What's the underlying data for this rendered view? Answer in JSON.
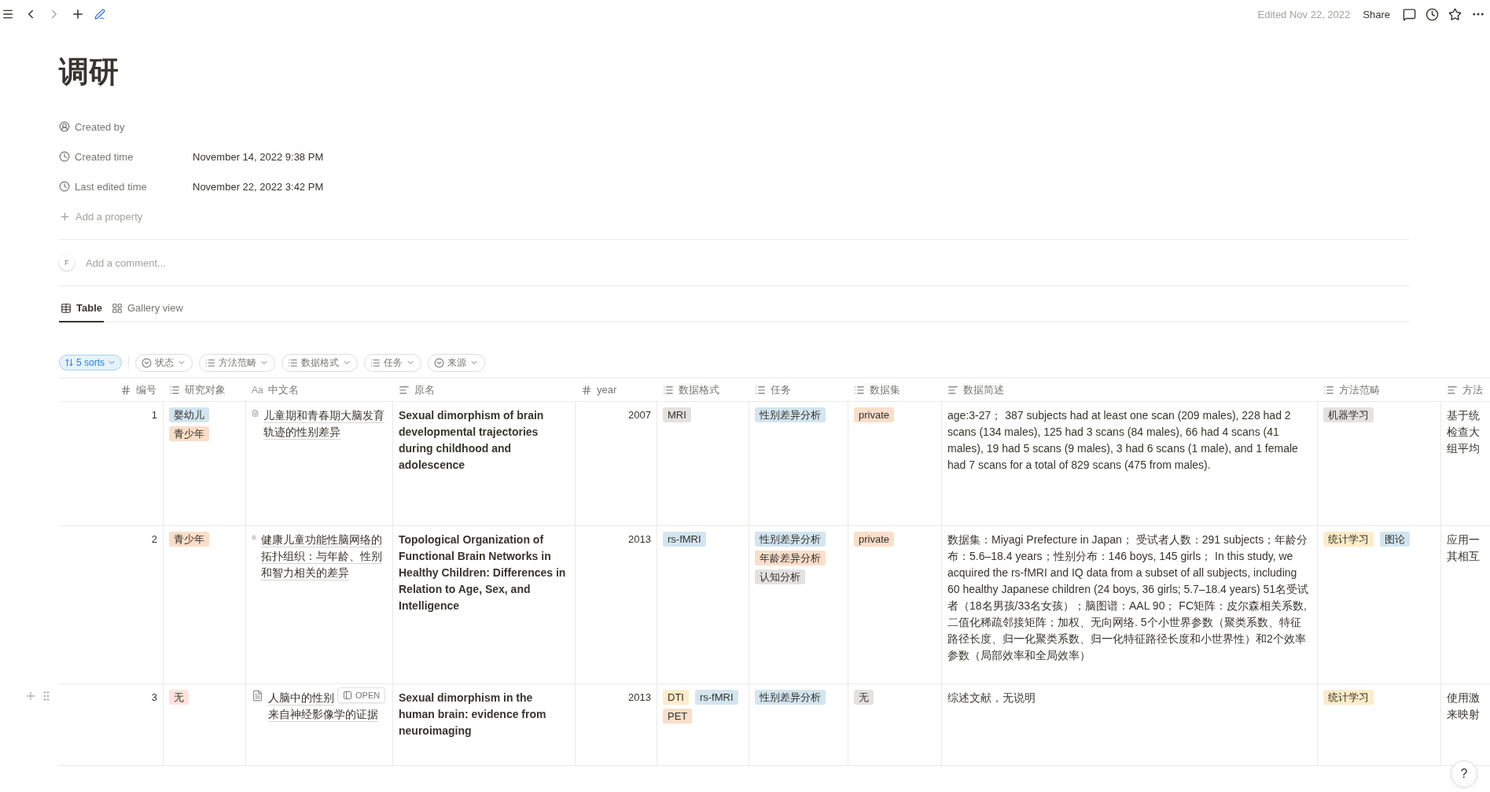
{
  "topbar": {
    "edited": "Edited Nov 22, 2022",
    "share": "Share"
  },
  "title": "调研",
  "properties": [
    {
      "kind": "person",
      "label": "Created by"
    },
    {
      "kind": "time",
      "label": "Created time",
      "value": "November 14, 2022 9:38 PM"
    },
    {
      "kind": "time",
      "label": "Last edited time",
      "value": "November 22, 2022 3:42 PM"
    }
  ],
  "add_property": "Add a property",
  "comment": {
    "avatar": "F",
    "placeholder": "Add a comment..."
  },
  "views": [
    {
      "kind": "table",
      "label": "Table",
      "selected": true
    },
    {
      "kind": "gallery",
      "label": "Gallery view",
      "selected": false
    }
  ],
  "sorts": {
    "label": "5 sorts",
    "active": true
  },
  "filters": [
    {
      "kind": "select",
      "label": "状态"
    },
    {
      "kind": "multi_select",
      "label": "方法范畴"
    },
    {
      "kind": "multi_select",
      "label": "数据格式"
    },
    {
      "kind": "multi_select",
      "label": "任务"
    },
    {
      "kind": "select",
      "label": "来源"
    }
  ],
  "table": {
    "columns": [
      {
        "label": "编号",
        "kind": "number"
      },
      {
        "label": "研究对象",
        "kind": "multi_select"
      },
      {
        "label": "中文名",
        "kind": "title",
        "prefix": "Aa"
      },
      {
        "label": "原名",
        "kind": "text",
        "bold": true
      },
      {
        "label": "year",
        "kind": "number"
      },
      {
        "label": "数据格式",
        "kind": "multi_select"
      },
      {
        "label": "任务",
        "kind": "multi_select"
      },
      {
        "label": "数据集",
        "kind": "multi_select"
      },
      {
        "label": "数据简述",
        "kind": "text",
        "bold": false
      },
      {
        "label": "方法范畴",
        "kind": "multi_select"
      },
      {
        "label": "方法",
        "kind": "text",
        "bold": false
      }
    ],
    "rows": [
      {
        "hovered": false,
        "cells": [
          "1",
          [
            {
              "label": "婴幼儿",
              "color": "#d3e5ef"
            },
            {
              "label": "青少年",
              "color": "#fadec9"
            }
          ],
          {
            "text": "儿童期和青春期大脑发育轨迹的性别差异"
          },
          "Sexual dimorphism of brain developmental trajectories during childhood and adolescence",
          "2007",
          [
            {
              "label": "MRI",
              "color": "#e3e2e0"
            }
          ],
          [
            {
              "label": "性别差异分析",
              "color": "#d3e5ef"
            }
          ],
          [
            {
              "label": "private",
              "color": "#fadec9"
            }
          ],
          "age:3-27；  387 subjects had at least one scan (209 males), 228 had 2 scans (134 males), 125 had 3 scans (84 males), 66 had 4 scans (41 males), 19 had 5 scans (9 males), 3 had 6 scans (1 male), and 1 female had 7 scans for a total of 829 scans (475 from males).",
          [
            {
              "label": "机器学习",
              "color": "#e3e2e0"
            }
          ],
          "基于统检查大组平均"
        ]
      },
      {
        "hovered": false,
        "cells": [
          "2",
          [
            {
              "label": "青少年",
              "color": "#fadec9"
            }
          ],
          {
            "text": "健康儿童功能性脑网络的拓扑组织：与年龄、性别和智力相关的差异"
          },
          "Topological Organization of Functional Brain Networks in Healthy Children: Differences in Relation to Age, Sex, and Intelligence",
          "2013",
          [
            {
              "label": "rs-fMRI",
              "color": "#d3e5ef"
            }
          ],
          [
            {
              "label": "性别差异分析",
              "color": "#d3e5ef"
            },
            {
              "label": "年龄差异分析",
              "color": "#fadec9"
            },
            {
              "label": "认知分析",
              "color": "#e3e2e0"
            }
          ],
          [
            {
              "label": "private",
              "color": "#fadec9"
            }
          ],
          "数据集：Miyagi Prefecture in Japan；  受试者人数：291 subjects；年龄分布：5.6–18.4 years；性别分布：146 boys, 145 girls； In this study, we acquired the rs-fMRI and IQ data from a subset of all subjects, including 60 healthy Japanese children (24 boys, 36 girls; 5.7–18.4 years) 51名受试者（18名男孩/33名女孩）；脑图谱：AAL 90； FC矩阵：皮尔森相关系数, 二值化稀疏邻接矩阵；加权、无向网络. 5个小世界参数（聚类系数、特征路径长度、归一化聚类系数、归一化特征路径长度和小世界性）和2个效率参数（局部效率和全局效率）",
          [
            {
              "label": "统计学习",
              "color": "#fdecc8"
            },
            {
              "label": "图论",
              "color": "#d3e5ef"
            }
          ],
          "应用一其相互"
        ]
      },
      {
        "hovered": true,
        "cells": [
          "3",
          [
            {
              "label": "无",
              "color": "#ffe2dd"
            }
          ],
          {
            "text": "人脑中的性别",
            "text_continued": "来自神经影像学的证据",
            "open_button": "OPEN"
          },
          "Sexual dimorphism in the human brain: evidence from neuroimaging",
          "2013",
          [
            {
              "label": "DTI",
              "color": "#fdecc8"
            },
            {
              "label": "rs-fMRI",
              "color": "#d3e5ef"
            },
            {
              "label": "PET",
              "color": "#fadec9"
            }
          ],
          [
            {
              "label": "性别差异分析",
              "color": "#d3e5ef"
            }
          ],
          [
            {
              "label": "无",
              "color": "#e3e2e0"
            }
          ],
          "综述文献，无说明",
          [
            {
              "label": "统计学习",
              "color": "#fdecc8"
            }
          ],
          "使用激来映射"
        ]
      }
    ]
  },
  "help": "?"
}
